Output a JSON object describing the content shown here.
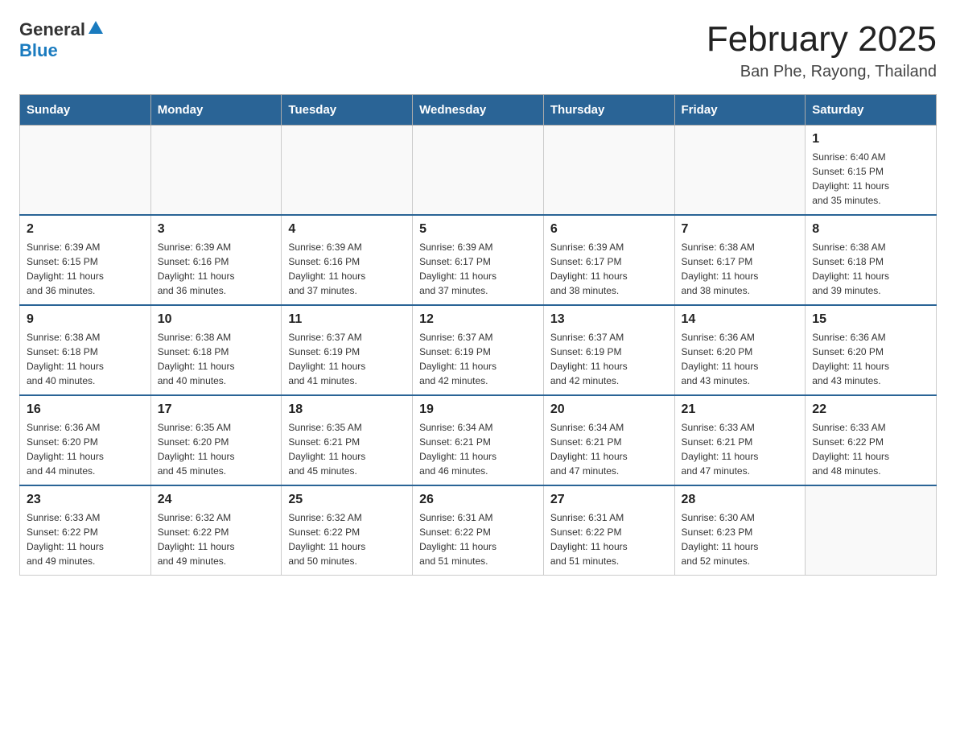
{
  "header": {
    "logo_general": "General",
    "logo_blue": "Blue",
    "month_title": "February 2025",
    "location": "Ban Phe, Rayong, Thailand"
  },
  "days_of_week": [
    "Sunday",
    "Monday",
    "Tuesday",
    "Wednesday",
    "Thursday",
    "Friday",
    "Saturday"
  ],
  "weeks": [
    [
      {
        "day": "",
        "info": ""
      },
      {
        "day": "",
        "info": ""
      },
      {
        "day": "",
        "info": ""
      },
      {
        "day": "",
        "info": ""
      },
      {
        "day": "",
        "info": ""
      },
      {
        "day": "",
        "info": ""
      },
      {
        "day": "1",
        "info": "Sunrise: 6:40 AM\nSunset: 6:15 PM\nDaylight: 11 hours\nand 35 minutes."
      }
    ],
    [
      {
        "day": "2",
        "info": "Sunrise: 6:39 AM\nSunset: 6:15 PM\nDaylight: 11 hours\nand 36 minutes."
      },
      {
        "day": "3",
        "info": "Sunrise: 6:39 AM\nSunset: 6:16 PM\nDaylight: 11 hours\nand 36 minutes."
      },
      {
        "day": "4",
        "info": "Sunrise: 6:39 AM\nSunset: 6:16 PM\nDaylight: 11 hours\nand 37 minutes."
      },
      {
        "day": "5",
        "info": "Sunrise: 6:39 AM\nSunset: 6:17 PM\nDaylight: 11 hours\nand 37 minutes."
      },
      {
        "day": "6",
        "info": "Sunrise: 6:39 AM\nSunset: 6:17 PM\nDaylight: 11 hours\nand 38 minutes."
      },
      {
        "day": "7",
        "info": "Sunrise: 6:38 AM\nSunset: 6:17 PM\nDaylight: 11 hours\nand 38 minutes."
      },
      {
        "day": "8",
        "info": "Sunrise: 6:38 AM\nSunset: 6:18 PM\nDaylight: 11 hours\nand 39 minutes."
      }
    ],
    [
      {
        "day": "9",
        "info": "Sunrise: 6:38 AM\nSunset: 6:18 PM\nDaylight: 11 hours\nand 40 minutes."
      },
      {
        "day": "10",
        "info": "Sunrise: 6:38 AM\nSunset: 6:18 PM\nDaylight: 11 hours\nand 40 minutes."
      },
      {
        "day": "11",
        "info": "Sunrise: 6:37 AM\nSunset: 6:19 PM\nDaylight: 11 hours\nand 41 minutes."
      },
      {
        "day": "12",
        "info": "Sunrise: 6:37 AM\nSunset: 6:19 PM\nDaylight: 11 hours\nand 42 minutes."
      },
      {
        "day": "13",
        "info": "Sunrise: 6:37 AM\nSunset: 6:19 PM\nDaylight: 11 hours\nand 42 minutes."
      },
      {
        "day": "14",
        "info": "Sunrise: 6:36 AM\nSunset: 6:20 PM\nDaylight: 11 hours\nand 43 minutes."
      },
      {
        "day": "15",
        "info": "Sunrise: 6:36 AM\nSunset: 6:20 PM\nDaylight: 11 hours\nand 43 minutes."
      }
    ],
    [
      {
        "day": "16",
        "info": "Sunrise: 6:36 AM\nSunset: 6:20 PM\nDaylight: 11 hours\nand 44 minutes."
      },
      {
        "day": "17",
        "info": "Sunrise: 6:35 AM\nSunset: 6:20 PM\nDaylight: 11 hours\nand 45 minutes."
      },
      {
        "day": "18",
        "info": "Sunrise: 6:35 AM\nSunset: 6:21 PM\nDaylight: 11 hours\nand 45 minutes."
      },
      {
        "day": "19",
        "info": "Sunrise: 6:34 AM\nSunset: 6:21 PM\nDaylight: 11 hours\nand 46 minutes."
      },
      {
        "day": "20",
        "info": "Sunrise: 6:34 AM\nSunset: 6:21 PM\nDaylight: 11 hours\nand 47 minutes."
      },
      {
        "day": "21",
        "info": "Sunrise: 6:33 AM\nSunset: 6:21 PM\nDaylight: 11 hours\nand 47 minutes."
      },
      {
        "day": "22",
        "info": "Sunrise: 6:33 AM\nSunset: 6:22 PM\nDaylight: 11 hours\nand 48 minutes."
      }
    ],
    [
      {
        "day": "23",
        "info": "Sunrise: 6:33 AM\nSunset: 6:22 PM\nDaylight: 11 hours\nand 49 minutes."
      },
      {
        "day": "24",
        "info": "Sunrise: 6:32 AM\nSunset: 6:22 PM\nDaylight: 11 hours\nand 49 minutes."
      },
      {
        "day": "25",
        "info": "Sunrise: 6:32 AM\nSunset: 6:22 PM\nDaylight: 11 hours\nand 50 minutes."
      },
      {
        "day": "26",
        "info": "Sunrise: 6:31 AM\nSunset: 6:22 PM\nDaylight: 11 hours\nand 51 minutes."
      },
      {
        "day": "27",
        "info": "Sunrise: 6:31 AM\nSunset: 6:22 PM\nDaylight: 11 hours\nand 51 minutes."
      },
      {
        "day": "28",
        "info": "Sunrise: 6:30 AM\nSunset: 6:23 PM\nDaylight: 11 hours\nand 52 minutes."
      },
      {
        "day": "",
        "info": ""
      }
    ]
  ]
}
